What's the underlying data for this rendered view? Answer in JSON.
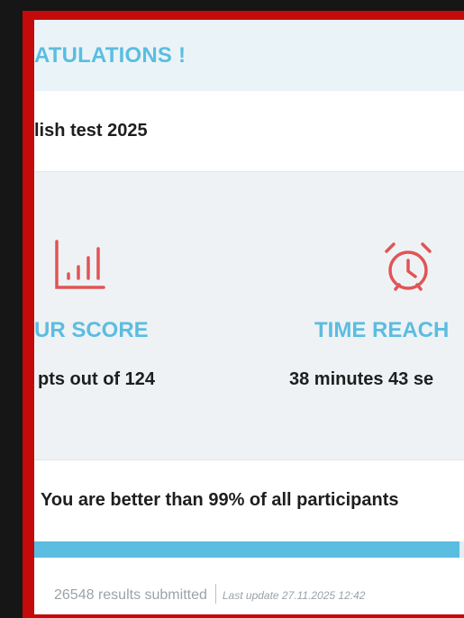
{
  "header": {
    "title": "ATULATIONS !"
  },
  "test": {
    "name": "lish test 2025"
  },
  "stats": {
    "score": {
      "label": "UR SCORE",
      "value": "pts out of 124"
    },
    "time": {
      "label": "TIME REACH",
      "value": "38 minutes 43 se"
    }
  },
  "ranking": {
    "text": "You are better than 99% of all participants",
    "percent": 99
  },
  "footer": {
    "results": "26548 results submitted",
    "last_update": "Last update 27.11.2025 12:42"
  },
  "colors": {
    "frame": "#c40a0a",
    "accent": "#5bbde0",
    "icon": "#e05555"
  },
  "icons": {
    "score": "bar-chart-icon",
    "time": "alarm-clock-icon"
  }
}
